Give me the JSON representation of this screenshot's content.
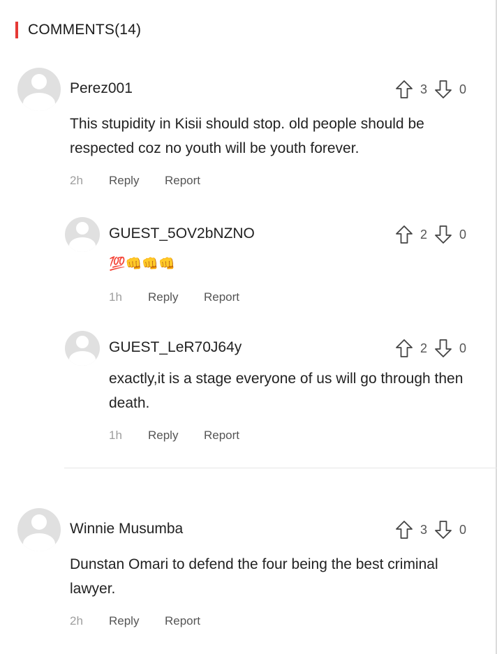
{
  "header": {
    "title": "COMMENTS(14)"
  },
  "comments": [
    {
      "author": "Perez001",
      "text": "This stupidity in Kisii should stop. old people should be respected coz no youth will be youth forever.",
      "time": "2h",
      "upvotes": "3",
      "downvotes": "0",
      "reply_label": "Reply",
      "report_label": "Report"
    },
    {
      "author": "GUEST_5OV2bNZNO",
      "text": "💯👊👊👊",
      "time": "1h",
      "upvotes": "2",
      "downvotes": "0",
      "reply_label": "Reply",
      "report_label": "Report"
    },
    {
      "author": "GUEST_LeR70J64y",
      "text": "exactly,it is a stage everyone of us will go through then death.",
      "time": "1h",
      "upvotes": "2",
      "downvotes": "0",
      "reply_label": "Reply",
      "report_label": "Report"
    },
    {
      "author": "Winnie Musumba",
      "text": "Dunstan Omari to defend the four being the best criminal lawyer.",
      "time": "2h",
      "upvotes": "3",
      "downvotes": "0",
      "reply_label": "Reply",
      "report_label": "Report"
    }
  ],
  "colors": {
    "accent": "#e53935",
    "avatar_bg": "#e0e0e0",
    "muted_text": "#9e9e9e",
    "action_text": "#555555"
  },
  "icons": {
    "avatar": "default-user-avatar-icon",
    "upvote": "arrow-up-outline-icon",
    "downvote": "arrow-down-outline-icon"
  }
}
